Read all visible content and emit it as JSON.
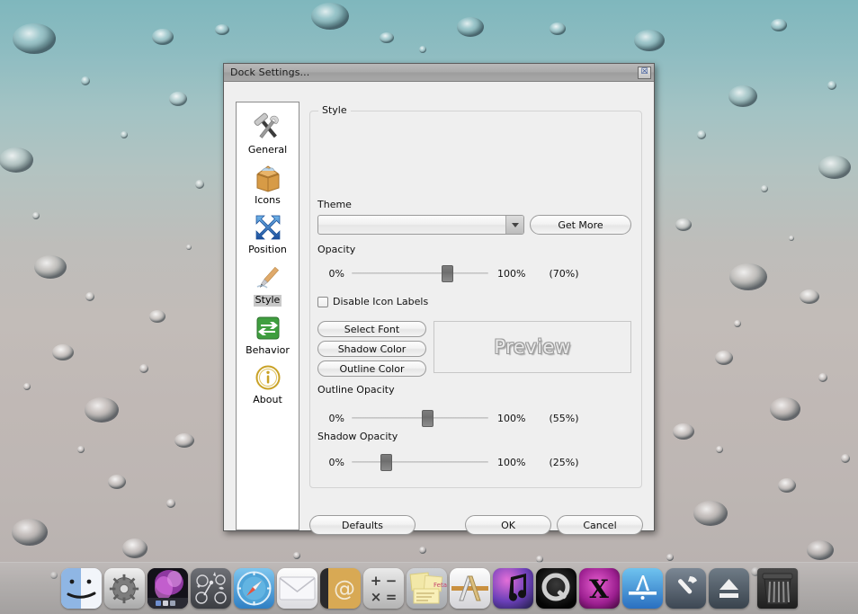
{
  "desktop": {
    "wallpaper_name": "water-droplets-wallpaper",
    "gradient_top": "#7fb7bd",
    "gradient_bottom": "#b0aaa8"
  },
  "dialog": {
    "title": "Dock Settings...",
    "close_label": "☒"
  },
  "sidebar": {
    "items": [
      {
        "label": "General",
        "icon": "hammer-wrench-icon",
        "selected": false
      },
      {
        "label": "Icons",
        "icon": "box-icon",
        "selected": false
      },
      {
        "label": "Position",
        "icon": "arrows-cross-icon",
        "selected": false
      },
      {
        "label": "Style",
        "icon": "pen-icon",
        "selected": true
      },
      {
        "label": "Behavior",
        "icon": "green-arrows-icon",
        "selected": false
      },
      {
        "label": "About",
        "icon": "info-icon",
        "selected": false
      }
    ]
  },
  "style_panel": {
    "group_title": "Style",
    "theme_label": "Theme",
    "theme_value": "",
    "theme_placeholder": "",
    "get_more_label": "Get More",
    "opacity_label": "Opacity",
    "opacity": {
      "min_label": "0%",
      "max_label": "100%",
      "value_label": "(70%)",
      "value": 70
    },
    "disable_icon_labels_label": "Disable Icon Labels",
    "disable_icon_labels_checked": false,
    "select_font_label": "Select Font",
    "shadow_color_label": "Shadow Color",
    "outline_color_label": "Outline Color",
    "preview_text": "Preview",
    "outline_opacity_label": "Outline Opacity",
    "outline_opacity": {
      "min_label": "0%",
      "max_label": "100%",
      "value_label": "(55%)",
      "value": 55
    },
    "shadow_opacity_label": "Shadow Opacity",
    "shadow_opacity": {
      "min_label": "0%",
      "max_label": "100%",
      "value_label": "(25%)",
      "value": 25
    }
  },
  "footer": {
    "defaults_label": "Defaults",
    "ok_label": "OK",
    "cancel_label": "Cancel"
  },
  "dock": {
    "items": [
      {
        "name": "finder-icon",
        "label": "Finder"
      },
      {
        "name": "system-preferences-icon",
        "label": "System Preferences"
      },
      {
        "name": "desktop-wallpaper-icon",
        "label": "Desktop"
      },
      {
        "name": "dashboard-icon",
        "label": "Dashboard"
      },
      {
        "name": "safari-icon",
        "label": "Safari"
      },
      {
        "name": "mail-icon",
        "label": "Mail"
      },
      {
        "name": "address-book-icon",
        "label": "Address Book"
      },
      {
        "name": "calculator-icon",
        "label": "Calculator"
      },
      {
        "name": "stickies-icon",
        "label": "Stickies"
      },
      {
        "name": "font-book-icon",
        "label": "Font Book"
      },
      {
        "name": "itunes-icon",
        "label": "iTunes"
      },
      {
        "name": "quicktime-icon",
        "label": "QuickTime Player"
      },
      {
        "name": "x11-icon",
        "label": "X11"
      },
      {
        "name": "app-store-icon",
        "label": "App Store"
      },
      {
        "name": "xcode-icon",
        "label": "Xcode"
      },
      {
        "name": "eject-icon",
        "label": "Eject"
      },
      {
        "name": "trash-icon",
        "label": "Trash"
      }
    ]
  }
}
